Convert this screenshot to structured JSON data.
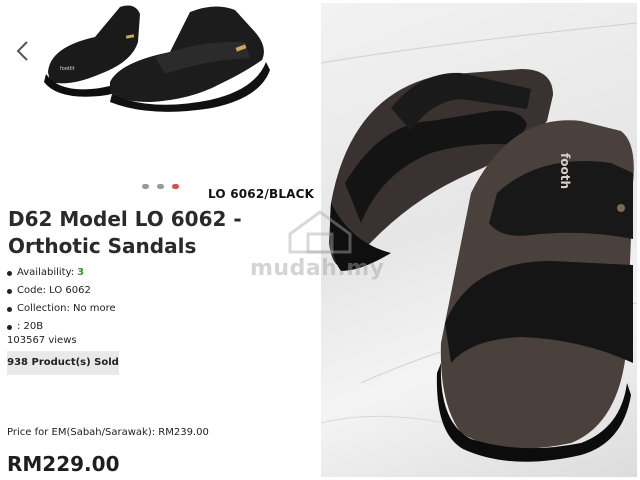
{
  "product": {
    "variant_label": "LO 6062/BLACK",
    "title": "D62 Model LO 6062 - Orthotic Sandals",
    "availability_label": "Availability:",
    "availability_value": "3",
    "code": "Code: LO 6062",
    "collection": "Collection: No more",
    "size": ": 20B",
    "views": "103567 views",
    "sold": "938 Product(s) Sold",
    "price_em": "Price for EM(Sabah/Sarawak): RM239.00",
    "price": "RM229.00",
    "thumb_brand_text": "footlit",
    "photo_brand_text": "footh"
  },
  "gallery": {
    "dots_count": 3,
    "active_dot": 2,
    "back_icon": "chevron-left-icon"
  },
  "watermark": {
    "text": "mudah.my"
  },
  "colors": {
    "accent_red": "#d9534f",
    "availability_green": "#2e9a2e",
    "sold_badge_bg": "#e9e9e9"
  }
}
